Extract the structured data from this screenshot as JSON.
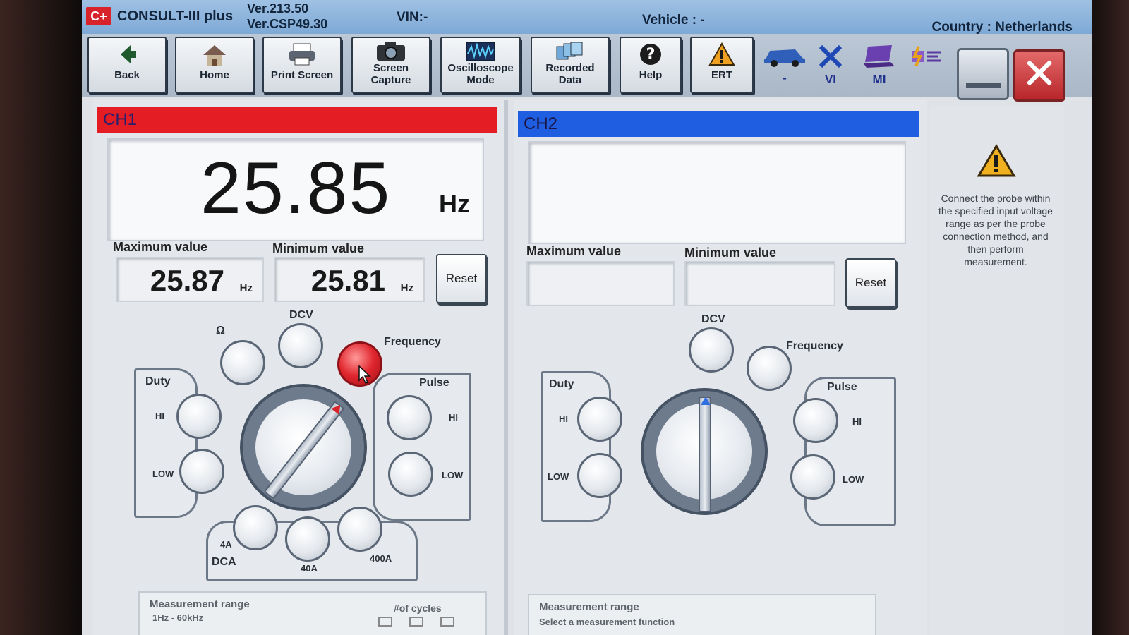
{
  "titlebar": {
    "logo": "C+",
    "app_name": "CONSULT-III plus",
    "version_1": "Ver.213.50",
    "version_2": "Ver.CSP49.30",
    "vin": "VIN:-",
    "vehicle": "Vehicle : -",
    "country": "Country : Netherlands"
  },
  "toolbar": {
    "back": "Back",
    "home": "Home",
    "print_screen": "Print Screen",
    "screen_capture_1": "Screen",
    "screen_capture_2": "Capture",
    "oscilloscope_1": "Oscilloscope",
    "oscilloscope_2": "Mode",
    "recorded_1": "Recorded",
    "recorded_2": "Data",
    "help": "Help",
    "ert": "ERT",
    "vehicle_tool": "-",
    "vi": "VI",
    "mi": "MI"
  },
  "ch1": {
    "label": "CH1",
    "bar_color": "#e31d23",
    "value": "25.85",
    "unit": "Hz",
    "max_label": "Maximum value",
    "max_value": "25.87",
    "max_unit": "Hz",
    "min_label": "Minimum value",
    "min_value": "25.81",
    "min_unit": "Hz",
    "reset": "Reset",
    "ohm": "Ω",
    "dcv": "DCV",
    "frequency": "Frequency",
    "duty": "Duty",
    "duty_hi": "HI",
    "duty_low": "LOW",
    "pulse": "Pulse",
    "pulse_hi": "HI",
    "pulse_low": "LOW",
    "a4": "4A",
    "a40": "40A",
    "a400": "400A",
    "dca": "DCA",
    "selected_mode": "Frequency",
    "range_label": "Measurement range",
    "range_value": "1Hz - 60kHz",
    "cycles_label": "#of cycles"
  },
  "ch2": {
    "label": "CH2",
    "bar_color": "#1f5ee0",
    "max_label": "Maximum value",
    "min_label": "Minimum value",
    "reset": "Reset",
    "dcv": "DCV",
    "frequency": "Frequency",
    "duty": "Duty",
    "duty_hi": "HI",
    "duty_low": "LOW",
    "pulse": "Pulse",
    "pulse_hi": "HI",
    "pulse_low": "LOW",
    "range_label": "Measurement range",
    "range_hint": "Select a measurement function"
  },
  "warning": {
    "text": "Connect the probe within the specified input voltage range as per the probe connection method, and then perform measurement."
  }
}
